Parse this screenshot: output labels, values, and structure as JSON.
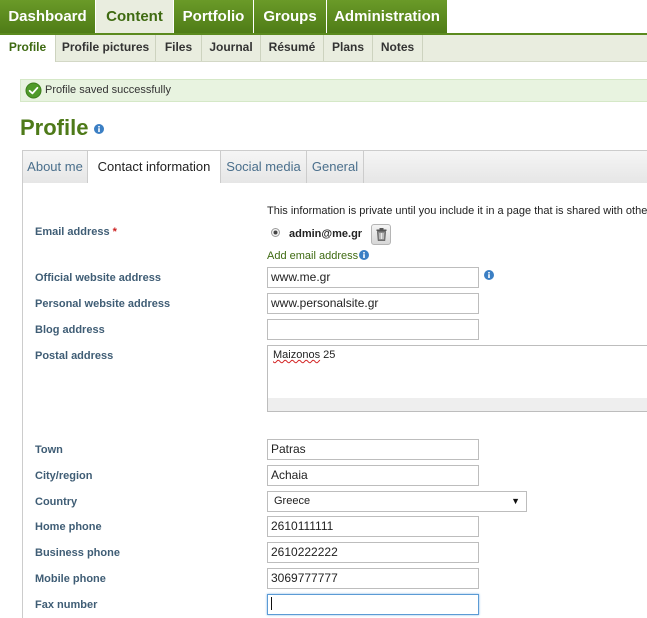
{
  "main_nav": {
    "items": [
      {
        "label": "Dashboard"
      },
      {
        "label": "Content",
        "selected": true
      },
      {
        "label": "Portfolio"
      },
      {
        "label": "Groups"
      },
      {
        "label": "Administration"
      }
    ]
  },
  "sub_nav": {
    "items": [
      {
        "label": "Profile",
        "selected": true
      },
      {
        "label": "Profile pictures"
      },
      {
        "label": "Files"
      },
      {
        "label": "Journal"
      },
      {
        "label": "Résumé"
      },
      {
        "label": "Plans"
      },
      {
        "label": "Notes"
      }
    ]
  },
  "message": {
    "text": "Profile saved successfully",
    "icon": "check-circle-icon"
  },
  "page": {
    "title": "Profile",
    "info_icon": "info-icon"
  },
  "tabs": [
    {
      "label": "About me"
    },
    {
      "label": "Contact information",
      "selected": true
    },
    {
      "label": "Social media"
    },
    {
      "label": "General"
    }
  ],
  "form": {
    "privacy_note": "This information is private until you include it in a page that is shared with others.",
    "email": {
      "label": "Email address",
      "required_mark": "*",
      "value": "admin@me.gr",
      "add_link": "Add email address"
    },
    "official_website": {
      "label": "Official website address",
      "value": "www.me.gr"
    },
    "personal_website": {
      "label": "Personal website address",
      "value": "www.personalsite.gr"
    },
    "blog": {
      "label": "Blog address",
      "value": ""
    },
    "postal": {
      "label": "Postal address",
      "value_word1": "Maizonos",
      "value_word2": " 25"
    },
    "town": {
      "label": "Town",
      "value": "Patras"
    },
    "city": {
      "label": "City/region",
      "value": "Achaia"
    },
    "country": {
      "label": "Country",
      "value": "Greece"
    },
    "home_phone": {
      "label": "Home phone",
      "value": "2610111111"
    },
    "business_phone": {
      "label": "Business phone",
      "value": "2610222222"
    },
    "mobile_phone": {
      "label": "Mobile phone",
      "value": "3069777777"
    },
    "fax": {
      "label": "Fax number",
      "value": ""
    }
  },
  "colors": {
    "brand_green": "#5b8a1e",
    "title_green": "#4e7a19",
    "label_blue": "#3f5d75",
    "info_blue": "#3b7fc4",
    "success_bg": "#e8f3e0"
  }
}
